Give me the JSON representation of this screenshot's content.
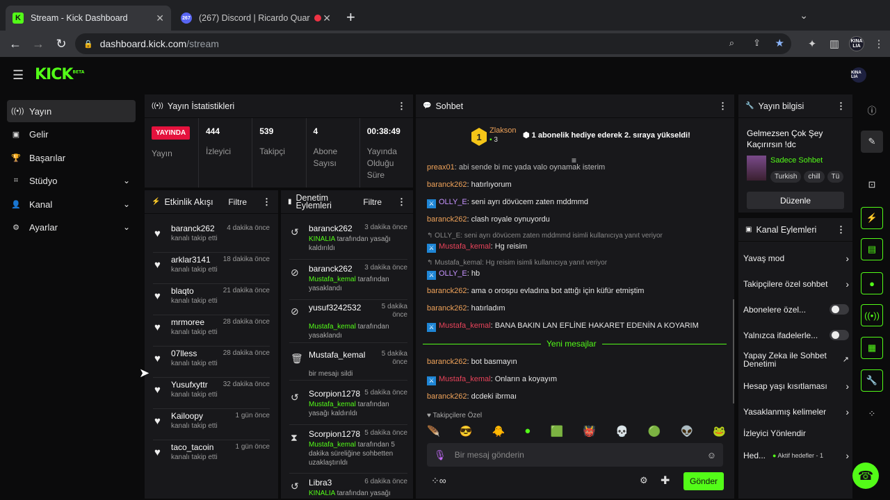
{
  "browser": {
    "tabs": [
      {
        "title": "Stream - Kick Dashboard"
      },
      {
        "title": "(267) Discord | Ricardo Quare"
      }
    ],
    "discord_badge": "267",
    "url_domain": "dashboard.kick.com",
    "url_path": "/stream",
    "profile_label": "KINA LIA"
  },
  "app": {
    "logo": "KICK",
    "logo_beta": "BETA",
    "user_label": "KINA LIA"
  },
  "sidebar": {
    "items": [
      {
        "label": "Yayın",
        "icon": "broadcast-icon"
      },
      {
        "label": "Gelir",
        "icon": "revenue-icon"
      },
      {
        "label": "Başarılar",
        "icon": "trophy-icon"
      },
      {
        "label": "Stüdyo",
        "icon": "studio-icon"
      },
      {
        "label": "Kanal",
        "icon": "user-icon"
      },
      {
        "label": "Ayarlar",
        "icon": "gear-icon"
      }
    ]
  },
  "stats": {
    "title": "Yayın İstatistikleri",
    "live_badge": "YAYINDA",
    "live_label": "Yayın",
    "viewers": "444",
    "viewers_label": "İzleyici",
    "followers": "539",
    "followers_label": "Takipçi",
    "subs": "4",
    "subs_label": "Abone Sayısı",
    "uptime": "00:38:49",
    "uptime_label": "Yayında Olduğu Süre"
  },
  "activity": {
    "title": "Etkinlik Akışı",
    "filter": "Filtre",
    "items": [
      {
        "name": "baranck262",
        "time": "4 dakika önce",
        "desc": "kanalı takip etti"
      },
      {
        "name": "arklar3141",
        "time": "18 dakika önce",
        "desc": "kanalı takip etti"
      },
      {
        "name": "blaqto",
        "time": "21 dakika önce",
        "desc": "kanalı takip etti"
      },
      {
        "name": "mrmoree",
        "time": "28 dakika önce",
        "desc": "kanalı takip etti"
      },
      {
        "name": "07lless",
        "time": "28 dakika önce",
        "desc": "kanalı takip etti"
      },
      {
        "name": "Yusufxyttr",
        "time": "32 dakika önce",
        "desc": "kanalı takip etti"
      },
      {
        "name": "Kailoopy",
        "time": "1 gün önce",
        "desc": "kanalı takip etti"
      },
      {
        "name": "taco_tacoin",
        "time": "1 gün önce",
        "desc": "kanalı takip etti"
      }
    ]
  },
  "moderation": {
    "title": "Denetim Eylemleri",
    "filter": "Filtre",
    "items": [
      {
        "name": "baranck262",
        "time": "3 dakika önce",
        "by": "KINALIA",
        "desc": "tarafından yasağı kaldırıldı",
        "icon": "undo-icon"
      },
      {
        "name": "baranck262",
        "time": "3 dakika önce",
        "by": "Mustafa_kemal",
        "desc": "tarafından yasaklandı",
        "icon": "ban-icon"
      },
      {
        "name": "yusuf3242532",
        "time": "5 dakika önce",
        "by": "Mustafa_kemal",
        "desc": "tarafından yasaklandı",
        "icon": "ban-icon"
      },
      {
        "name": "Mustafa_kemal",
        "time": "5 dakika önce",
        "by": "",
        "desc": "bir mesajı sildi",
        "icon": "trash-icon"
      },
      {
        "name": "Scorpion1278",
        "time": "5 dakika önce",
        "by": "Mustafa_kemal",
        "desc": "tarafından yasağı kaldırıldı",
        "icon": "undo-icon"
      },
      {
        "name": "Scorpion1278",
        "time": "5 dakika önce",
        "by": "Mustafa_kemal",
        "desc": "tarafından 5 dakika süreliğine sohbetten uzaklaştırıldı",
        "icon": "hourglass-icon"
      },
      {
        "name": "Libra3",
        "time": "6 dakika önce",
        "by": "KINALIA",
        "desc": "tarafından yasağı",
        "icon": "undo-icon"
      }
    ]
  },
  "chat": {
    "title": "Sohbet",
    "sub_user": "Zlakson",
    "sub_badge": "1",
    "sub_count": "3",
    "sub_text": "1 abonelik hediye ederek 2. sıraya yükseldi!",
    "messages": [
      {
        "user": "preax01",
        "text": "abi sende bi mc yada valo oynamak isterim",
        "color": "o"
      },
      {
        "user": "baranck262",
        "text": "hatırlıyorum",
        "color": "o"
      },
      {
        "user": "OLLY_E",
        "text": "seni ayrı dövücem zaten mddmmd",
        "color": "p",
        "mod": true
      },
      {
        "user": "baranck262",
        "text": "clash royale oynuyordu",
        "color": "o"
      },
      {
        "reply": "OLLY_E: seni ayrı dövücem zaten mddmmd isimli kullanıcıya yanıt veriyor"
      },
      {
        "user": "Mustafa_kemal",
        "text": "Hg reisim",
        "color": "r",
        "mod": true
      },
      {
        "reply": "Mustafa_kemal: Hg reisim isimli kullanıcıya yanıt veriyor"
      },
      {
        "user": "OLLY_E",
        "text": "hb",
        "color": "p",
        "mod": true
      },
      {
        "user": "baranck262",
        "text": "ama o orospu evladına bot attığı için küfür etmiştim",
        "color": "o"
      },
      {
        "user": "baranck262",
        "text": "hatırladım",
        "color": "o"
      },
      {
        "user": "Mustafa_kemal",
        "text": "BANA BAKIN LAN EFLİNE HAKARET EDENİN A KOYARIM",
        "color": "r",
        "mod": true
      },
      {
        "user": "baranck262",
        "text": "bot basmayın",
        "color": "o"
      },
      {
        "user": "Mustafa_kemal",
        "text": "Onların a koyayım",
        "color": "r",
        "mod": true
      },
      {
        "user": "baranck262",
        "text": "dcdeki ibrmaı",
        "color": "o"
      }
    ],
    "new_messages": "Yeni mesajlar",
    "followers_only": "Takipçilere Özel",
    "placeholder": "Bir mesaj gönderin",
    "send": "Gönder"
  },
  "stream_info": {
    "title": "Yayın bilgisi",
    "stream_title": "Gelmezsen Çok Şey Kaçırırsın !dc",
    "category": "Sadece Sohbet",
    "tags": [
      "Turkish",
      "chill",
      "Tü"
    ],
    "edit": "Düzenle"
  },
  "channel_actions": {
    "title": "Kanal Eylemleri",
    "items": [
      {
        "label": "Yavaş mod",
        "kind": "arrow"
      },
      {
        "label": "Takipçilere özel sohbet",
        "kind": "arrow"
      },
      {
        "label": "Abonelere özel...",
        "kind": "toggle"
      },
      {
        "label": "Yalnızca ifadelerle...",
        "kind": "toggle"
      },
      {
        "label": "Yapay Zeka ile Sohbet Denetimi",
        "kind": "external"
      },
      {
        "label": "Hesap yaşı kısıtlaması",
        "kind": "arrow"
      },
      {
        "label": "Yasaklanmış kelimeler",
        "kind": "arrow"
      },
      {
        "label": "İzleyici Yönlendir",
        "kind": "none"
      },
      {
        "label": "Hed...",
        "kind": "arrow",
        "extra": "Aktif hedefler - 1"
      }
    ]
  },
  "colors": {
    "accent": "#53fc18",
    "live": "#e5123d",
    "panel": "#18181b"
  }
}
